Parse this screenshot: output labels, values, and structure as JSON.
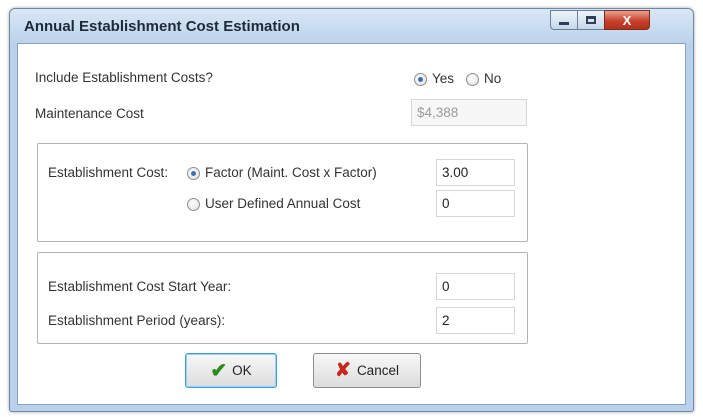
{
  "window": {
    "title": "Annual Establishment Cost Estimation",
    "controls": {
      "minimize_icon": "minimize-icon",
      "maximize_icon": "maximize-icon",
      "close_icon": "close-icon",
      "close_glyph": "X"
    }
  },
  "include": {
    "label": "Include Establishment Costs?",
    "yes_label": "Yes",
    "no_label": "No",
    "selected": "Yes"
  },
  "maintenance": {
    "label": "Maintenance Cost",
    "value": "$4,388"
  },
  "establishment": {
    "label": "Establishment Cost:",
    "factor_label": "Factor (Maint. Cost x Factor)",
    "factor_value": "3.00",
    "user_defined_label": "User Defined Annual Cost",
    "user_defined_value": "0",
    "selected": "Factor (Maint. Cost x Factor)"
  },
  "timing": {
    "start_year_label": "Establishment Cost Start Year:",
    "start_year_value": "0",
    "period_label": "Establishment Period (years):",
    "period_value": "2"
  },
  "buttons": {
    "ok_label": "OK",
    "cancel_label": "Cancel",
    "ok_icon": "checkmark-icon",
    "cancel_icon": "x-mark-icon"
  },
  "colors": {
    "title_bar": "#bcd3ea",
    "close_button": "#c7412a",
    "radio_dot": "#3e6fb2",
    "ok_check": "#2f8a1e",
    "cancel_x": "#c8281b"
  }
}
